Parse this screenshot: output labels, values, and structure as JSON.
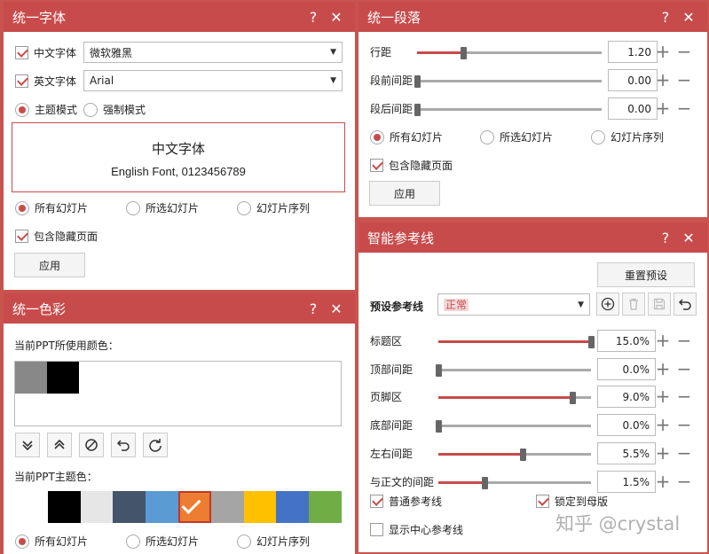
{
  "font_panel": {
    "title": "统一字体",
    "help": "?",
    "close": "✕",
    "cn_font": {
      "label": "中文字体",
      "value": "微软雅黑",
      "checked": true
    },
    "en_font": {
      "label": "英文字体",
      "value": "Arial",
      "checked": true
    },
    "mode_theme": "主题模式",
    "mode_force": "强制模式",
    "preview_cn": "中文字体",
    "preview_en": "English Font, 0123456789",
    "scope_all": "所有幻灯片",
    "scope_selected": "所选幻灯片",
    "scope_sequence": "幻灯片序列",
    "include_hidden": "包含隐藏页面",
    "apply": "应用"
  },
  "para_panel": {
    "title": "统一段落",
    "help": "?",
    "close": "✕",
    "line_spacing": {
      "label": "行距",
      "value": "1.20",
      "level": 0.25
    },
    "before": {
      "label": "段前间距",
      "value": "0.00",
      "level": 0
    },
    "after": {
      "label": "段后间距",
      "value": "0.00",
      "level": 0
    },
    "scope_all": "所有幻灯片",
    "scope_selected": "所选幻灯片",
    "scope_sequence": "幻灯片序列",
    "include_hidden": "包含隐藏页面",
    "apply": "应用"
  },
  "color_panel": {
    "title": "统一色彩",
    "help": "?",
    "close": "✕",
    "used_label": "当前PPT所使用颜色：",
    "used_colors": [
      "#888888",
      "#000000"
    ],
    "theme_label": "当前PPT主题色：",
    "theme_colors": [
      "#ffffff",
      "#000000",
      "#e7e6e6",
      "#44546a",
      "#5b9bd5",
      "#ed7d31",
      "#a5a5a5",
      "#ffc000",
      "#4472c4",
      "#70ad47"
    ],
    "selected_theme_color": "#ed7d31",
    "scope_all": "所有幻灯片",
    "scope_selected": "所选幻灯片",
    "scope_sequence": "幻灯片序列"
  },
  "guide_panel": {
    "title": "智能参考线",
    "help": "?",
    "close": "✕",
    "reset": "重置预设",
    "preset_label": "预设参考线",
    "preset_value": "正常",
    "rows": [
      {
        "label": "标题区",
        "value": "15.0%",
        "level": 1.0
      },
      {
        "label": "顶部间距",
        "value": "0.0%",
        "level": 0
      },
      {
        "label": "页脚区",
        "value": "9.0%",
        "level": 0.88
      },
      {
        "label": "底部间距",
        "value": "0.0%",
        "level": 0
      },
      {
        "label": "左右间距",
        "value": "5.5%",
        "level": 0.55
      },
      {
        "label": "与正文的间距",
        "value": "1.5%",
        "level": 0.3
      }
    ],
    "normal_guides": "普通参考线",
    "lock_master": "锁定到母版",
    "center_guides": "显示中心参考线",
    "watermark": "知乎 @crystal"
  },
  "accent_color": "#c84b4b"
}
